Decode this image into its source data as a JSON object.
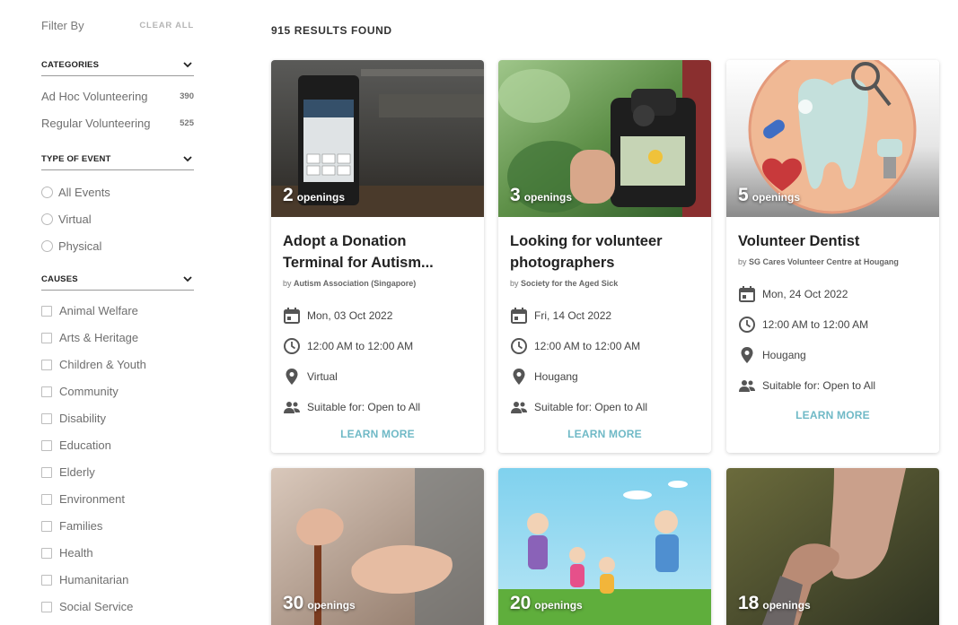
{
  "filters": {
    "title": "Filter By",
    "clear_all": "CLEAR ALL",
    "categories": {
      "title": "CATEGORIES",
      "items": [
        {
          "label": "Ad Hoc Volunteering",
          "count": "390"
        },
        {
          "label": "Regular Volunteering",
          "count": "525"
        }
      ]
    },
    "type_of_event": {
      "title": "TYPE OF EVENT",
      "options": [
        "All Events",
        "Virtual",
        "Physical"
      ]
    },
    "causes": {
      "title": "CAUSES",
      "options": [
        "Animal Welfare",
        "Arts & Heritage",
        "Children & Youth",
        "Community",
        "Disability",
        "Education",
        "Elderly",
        "Environment",
        "Families",
        "Health",
        "Humanitarian",
        "Social Service"
      ]
    }
  },
  "results": {
    "count_label": "915 RESULTS FOUND",
    "openings_label": "openings",
    "learn_more": "LEARN MORE",
    "cards": [
      {
        "openings": "2",
        "title_line1": "Adopt a Donation",
        "title_line2": "Terminal for Autism...",
        "by": "by",
        "org": "Autism Association (Singapore)",
        "date": "Mon, 03 Oct 2022",
        "time": "12:00 AM to 12:00 AM",
        "location": "Virtual",
        "suitable": "Suitable for: Open to All"
      },
      {
        "openings": "3",
        "title_line1": "Looking for volunteer",
        "title_line2": "photographers",
        "by": "by",
        "org": "Society for the Aged Sick",
        "date": "Fri, 14 Oct 2022",
        "time": "12:00 AM to 12:00 AM",
        "location": "Hougang",
        "suitable": "Suitable for: Open to All"
      },
      {
        "openings": "5",
        "title_line1": "Volunteer Dentist",
        "title_line2": "",
        "by": "by",
        "org": "SG Cares Volunteer Centre at Hougang",
        "date": "Mon, 24 Oct 2022",
        "time": "12:00 AM to 12:00 AM",
        "location": "Hougang",
        "suitable": "Suitable for: Open to All"
      },
      {
        "openings": "30"
      },
      {
        "openings": "20"
      },
      {
        "openings": "18"
      }
    ]
  },
  "colors": {
    "accent": "#6fb9c6",
    "icon": "#555555"
  }
}
